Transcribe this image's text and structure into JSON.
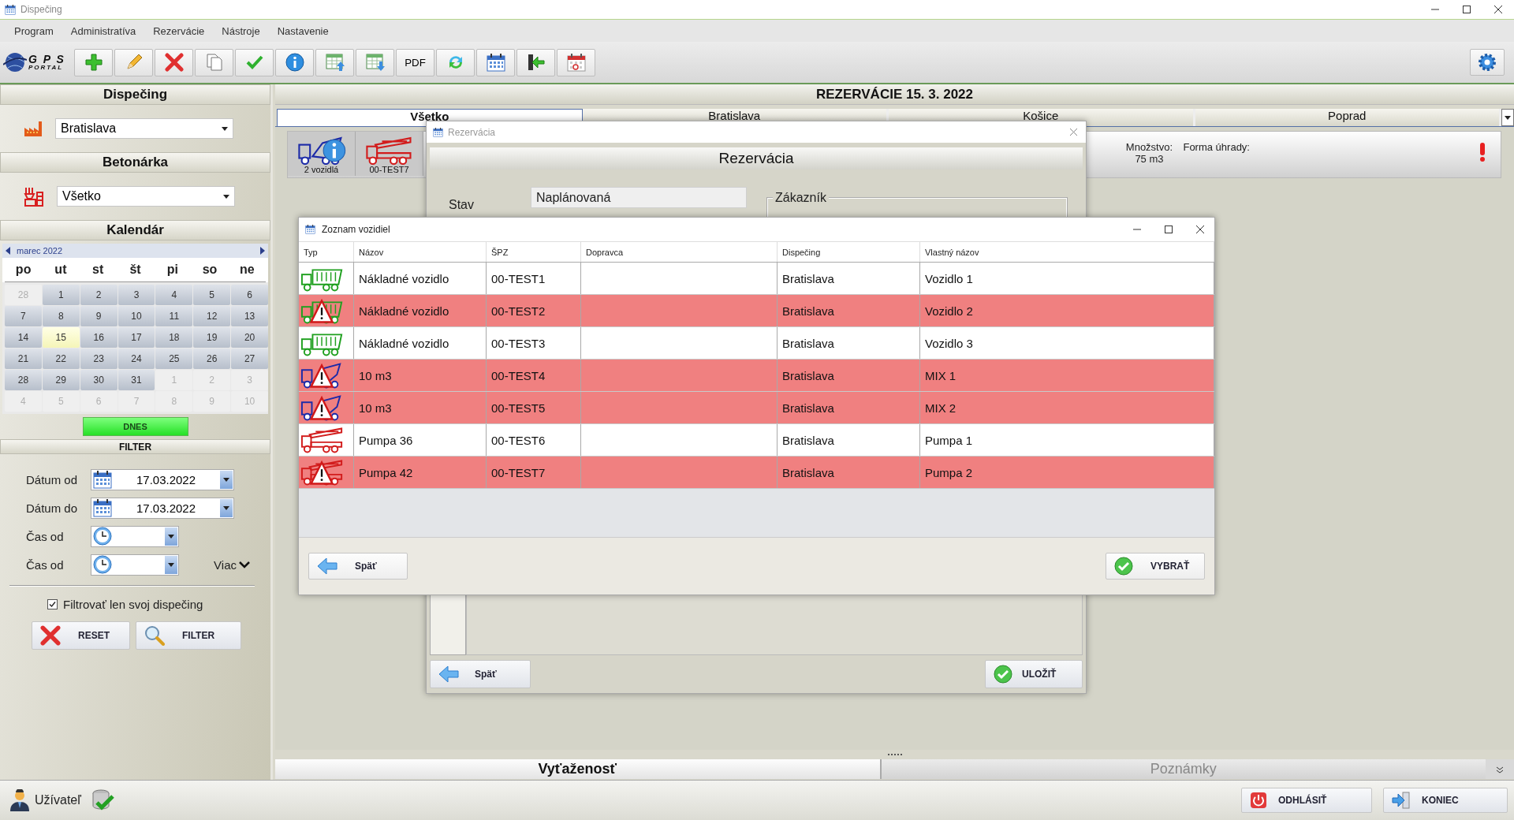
{
  "window": {
    "title": "Dispečing"
  },
  "menu": [
    {
      "label": "Program"
    },
    {
      "label": "Administratíva"
    },
    {
      "label": "Rezervácie"
    },
    {
      "label": "Nástroje"
    },
    {
      "label": "Nastavenie"
    }
  ],
  "toolbar": {
    "logo": {
      "top": "G P S",
      "bottom": "PORTAL"
    },
    "buttons": [
      {
        "kind": "add"
      },
      {
        "kind": "edit"
      },
      {
        "kind": "delete"
      },
      {
        "kind": "copy"
      },
      {
        "kind": "confirm"
      },
      {
        "kind": "info"
      },
      {
        "kind": "export"
      },
      {
        "kind": "import"
      },
      {
        "kind": "pdf",
        "text": "PDF"
      },
      {
        "kind": "refresh"
      },
      {
        "kind": "calendar"
      },
      {
        "kind": "exit"
      },
      {
        "kind": "calendar-remove"
      }
    ]
  },
  "sidebar": {
    "dispatch": {
      "title": "Dispečing",
      "value": "Bratislava"
    },
    "plant": {
      "title": "Betonárka",
      "value": "Všetko"
    },
    "calendar": {
      "title": "Kalendár",
      "month": "marec 2022",
      "weekdays": [
        "po",
        "ut",
        "st",
        "št",
        "pi",
        "so",
        "ne"
      ],
      "days": [
        {
          "label": "28",
          "outside": true,
          "selected": false
        },
        {
          "label": "1",
          "outside": false,
          "selected": false
        },
        {
          "label": "2",
          "outside": false,
          "selected": false
        },
        {
          "label": "3",
          "outside": false,
          "selected": false
        },
        {
          "label": "4",
          "outside": false,
          "selected": false
        },
        {
          "label": "5",
          "outside": false,
          "selected": false
        },
        {
          "label": "6",
          "outside": false,
          "selected": false
        },
        {
          "label": "7",
          "outside": false,
          "selected": false
        },
        {
          "label": "8",
          "outside": false,
          "selected": false
        },
        {
          "label": "9",
          "outside": false,
          "selected": false
        },
        {
          "label": "10",
          "outside": false,
          "selected": false
        },
        {
          "label": "11",
          "outside": false,
          "selected": false
        },
        {
          "label": "12",
          "outside": false,
          "selected": false
        },
        {
          "label": "13",
          "outside": false,
          "selected": false
        },
        {
          "label": "14",
          "outside": false,
          "selected": false
        },
        {
          "label": "15",
          "outside": false,
          "selected": true
        },
        {
          "label": "16",
          "outside": false,
          "selected": false
        },
        {
          "label": "17",
          "outside": false,
          "selected": false
        },
        {
          "label": "18",
          "outside": false,
          "selected": false
        },
        {
          "label": "19",
          "outside": false,
          "selected": false
        },
        {
          "label": "20",
          "outside": false,
          "selected": false
        },
        {
          "label": "21",
          "outside": false,
          "selected": false
        },
        {
          "label": "22",
          "outside": false,
          "selected": false
        },
        {
          "label": "23",
          "outside": false,
          "selected": false
        },
        {
          "label": "24",
          "outside": false,
          "selected": false
        },
        {
          "label": "25",
          "outside": false,
          "selected": false
        },
        {
          "label": "26",
          "outside": false,
          "selected": false
        },
        {
          "label": "27",
          "outside": false,
          "selected": false
        },
        {
          "label": "28",
          "outside": false,
          "selected": false
        },
        {
          "label": "29",
          "outside": false,
          "selected": false
        },
        {
          "label": "30",
          "outside": false,
          "selected": false
        },
        {
          "label": "31",
          "outside": false,
          "selected": false
        },
        {
          "label": "1",
          "outside": true,
          "selected": false
        },
        {
          "label": "2",
          "outside": true,
          "selected": false
        },
        {
          "label": "3",
          "outside": true,
          "selected": false
        },
        {
          "label": "4",
          "outside": true,
          "selected": false
        },
        {
          "label": "5",
          "outside": true,
          "selected": false
        },
        {
          "label": "6",
          "outside": true,
          "selected": false
        },
        {
          "label": "7",
          "outside": true,
          "selected": false
        },
        {
          "label": "8",
          "outside": true,
          "selected": false
        },
        {
          "label": "9",
          "outside": true,
          "selected": false
        },
        {
          "label": "10",
          "outside": true,
          "selected": false
        }
      ],
      "today_button": "DNES"
    },
    "filter": {
      "title": "FILTER",
      "fields": [
        {
          "label": "Dátum od",
          "kind": "date",
          "value": "17.03.2022"
        },
        {
          "label": "Dátum do",
          "kind": "date",
          "value": "17.03.2022"
        },
        {
          "label": "Čas od",
          "kind": "time"
        },
        {
          "label": "Čas od",
          "kind": "time"
        }
      ],
      "more": "Viac",
      "checkbox": {
        "label": "Filtrovať len svoj dispečing",
        "checked": true
      },
      "buttons": [
        {
          "label": "RESET",
          "kind": "reset"
        },
        {
          "label": "FILTER",
          "kind": "search"
        }
      ]
    }
  },
  "main": {
    "header": "REZERVÁCIE 15. 3. 2022",
    "tabs": [
      {
        "label": "Všetko",
        "selected": true
      },
      {
        "label": "Bratislava",
        "selected": false
      },
      {
        "label": "Košice",
        "selected": false
      },
      {
        "label": "Poprad",
        "selected": false
      }
    ],
    "reservation": {
      "vehicles": [
        {
          "label": "2 vozidlá",
          "kind": "mixer",
          "info": true
        },
        {
          "label": "00-TEST7",
          "kind": "pump",
          "info": false
        }
      ],
      "quantity_label": "Množstvo:",
      "quantity": "75 m3",
      "payment_label": "Forma úhrady:",
      "alert": true
    },
    "bottom_tabs": [
      {
        "label": "Vyťaženosť",
        "selected": true
      },
      {
        "label": "Poznámky",
        "selected": false
      }
    ]
  },
  "reservation_dialog": {
    "title": "Rezervácia",
    "header": "Rezervácia",
    "status_label": "Stav",
    "status_value": "Naplánovaná",
    "customer_group": "Zákazník",
    "back_button": "Späť",
    "save_button": "ULOŽIŤ"
  },
  "vehicle_dialog": {
    "title": "Zoznam vozidiel",
    "columns": [
      "Typ",
      "Názov",
      "ŠPZ",
      "Dopravca",
      "Dispečing",
      "Vlastný názov"
    ],
    "rows": [
      {
        "kind": "truck",
        "warning": false,
        "name": "Nákladné vozidlo",
        "plate": "00-TEST1",
        "dispatch": "Bratislava",
        "custom_name": "Vozidlo 1"
      },
      {
        "kind": "truck",
        "warning": true,
        "name": "Nákladné vozidlo",
        "plate": "00-TEST2",
        "dispatch": "Bratislava",
        "custom_name": "Vozidlo 2"
      },
      {
        "kind": "truck",
        "warning": false,
        "name": "Nákladné vozidlo",
        "plate": "00-TEST3",
        "dispatch": "Bratislava",
        "custom_name": "Vozidlo 3"
      },
      {
        "kind": "mixer",
        "warning": true,
        "name": "10 m3",
        "plate": "00-TEST4",
        "dispatch": "Bratislava",
        "custom_name": "MIX 1"
      },
      {
        "kind": "mixer",
        "warning": true,
        "name": "10 m3",
        "plate": "00-TEST5",
        "dispatch": "Bratislava",
        "custom_name": "MIX 2"
      },
      {
        "kind": "pump",
        "warning": false,
        "name": "Pumpa 36",
        "plate": "00-TEST6",
        "dispatch": "Bratislava",
        "custom_name": "Pumpa 1"
      },
      {
        "kind": "pump",
        "warning": true,
        "name": "Pumpa 42",
        "plate": "00-TEST7",
        "dispatch": "Bratislava",
        "custom_name": "Pumpa 2"
      }
    ],
    "back_button": "Späť",
    "select_button": "VYBRAŤ"
  },
  "status_bar": {
    "user": "Užívateľ",
    "buttons": [
      {
        "label": "ODHLÁSIŤ",
        "kind": "logout"
      },
      {
        "label": "KONIEC",
        "kind": "exit"
      }
    ]
  }
}
